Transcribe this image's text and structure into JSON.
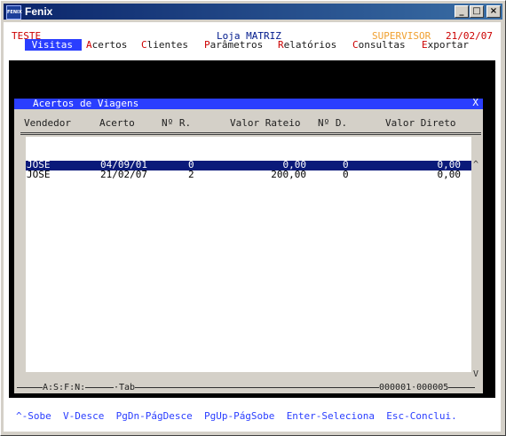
{
  "window": {
    "title": "Fenix",
    "icon_text": "FENIX"
  },
  "header": {
    "company": "TESTE",
    "store": "Loja MATRIZ",
    "role": "SUPERVISOR",
    "date": "21/02/07"
  },
  "menu": {
    "items": [
      {
        "hotkey": "V",
        "rest": "isitas"
      },
      {
        "hotkey": "A",
        "rest": "certos"
      },
      {
        "hotkey": "C",
        "rest": "lientes"
      },
      {
        "hotkey": "P",
        "rest": "arâmetros"
      },
      {
        "hotkey": "R",
        "rest": "elatórios"
      },
      {
        "hotkey": "C",
        "rest": "onsultas"
      },
      {
        "hotkey": "E",
        "rest": "xportar"
      }
    ]
  },
  "dialog": {
    "title": "Acertos de Viagens",
    "close_glyph": "X",
    "columns": [
      "Vendedor",
      "Acerto",
      "Nº R.",
      "Valor Rateio",
      "Nº D.",
      "Valor Direto"
    ],
    "rows": [
      {
        "vendedor": "JOSE",
        "acerto": "04/09/01",
        "nr": "0",
        "rateio": "0,00",
        "nd": "0",
        "direto": "0,00"
      },
      {
        "vendedor": "JOSE",
        "acerto": "21/02/07",
        "nr": "2",
        "rateio": "200,00",
        "nd": "0",
        "direto": "0,00"
      }
    ],
    "selected_row": 0,
    "scroll_up": "^",
    "scroll_down": "V",
    "status_left": "A:S:F:N:",
    "status_mid": "·Tab",
    "status_right": "000001·000005"
  },
  "help": {
    "items": [
      "^-Sobe",
      "V-Desce",
      "PgDn-PágDesce",
      "PgUp-PágSobe",
      "Enter-Seleciona",
      "Esc-Conclui."
    ]
  },
  "colors": {
    "menu_highlight": "#2a3eff",
    "selected_row": "#0a1a7a",
    "hotkey": "#cc0000",
    "role": "#f0a030"
  }
}
